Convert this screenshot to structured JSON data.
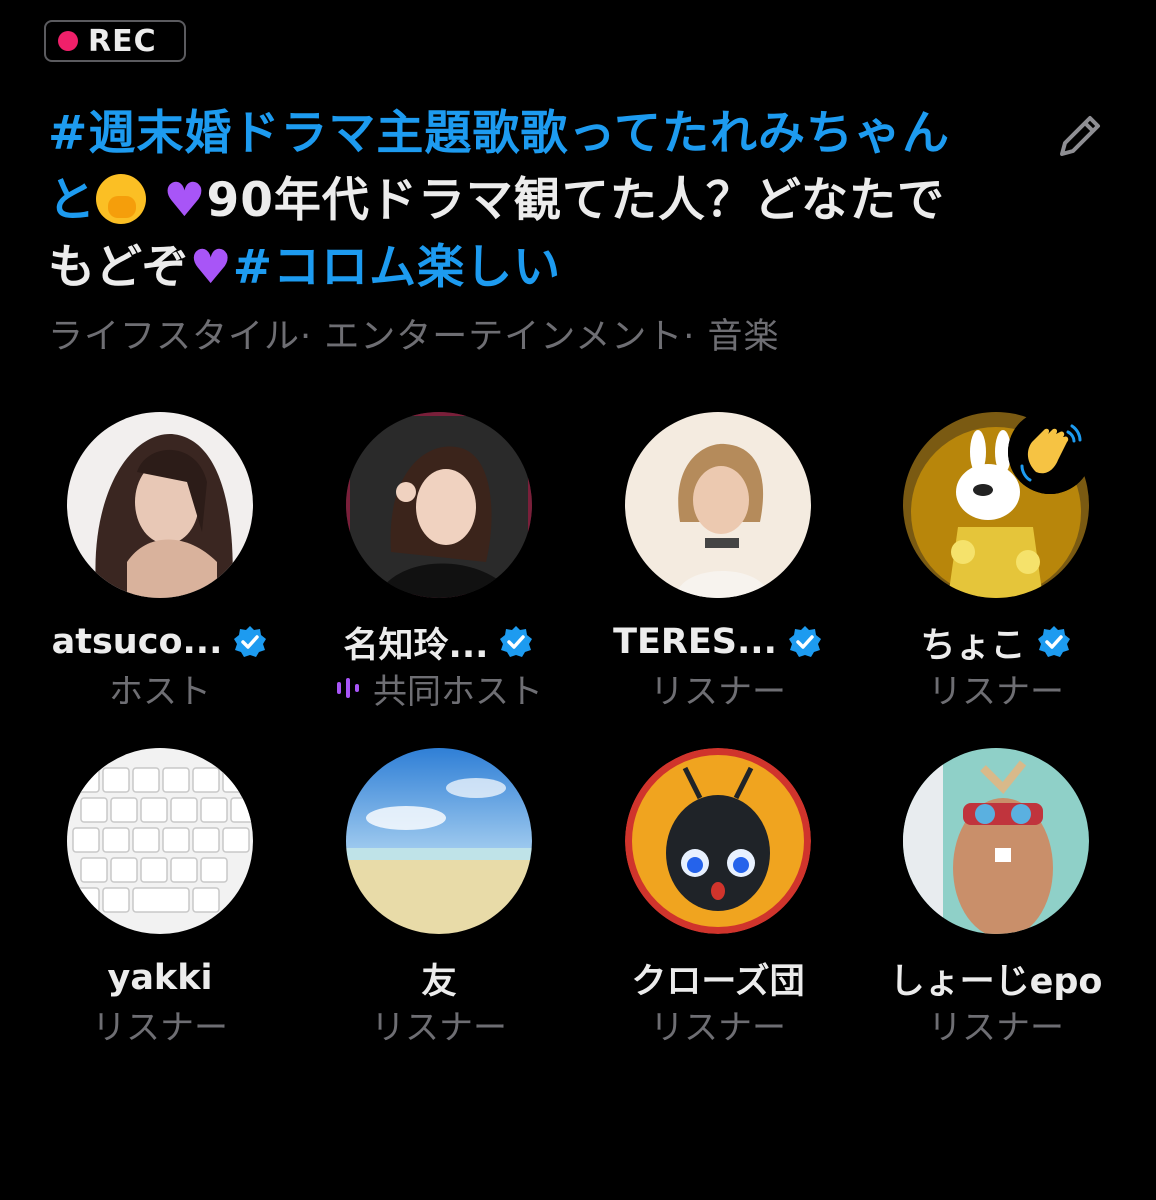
{
  "rec_badge": {
    "label": "REC"
  },
  "space": {
    "title_line1": "#週末婚ドラマ主題歌歌ってたれみちゃん",
    "title_line2_start": "と",
    "title_line2_after": "90年代ドラマ観てた人？どなたで",
    "title_line3_start": "もどぞ",
    "title_line3_tag": "#コロム楽しい",
    "categories": "ライフスタイル· エンターテインメント· 音楽"
  },
  "participants": [
    {
      "name": "atsuco...",
      "role": "ホスト",
      "verified": true,
      "speaking": false,
      "avatar": "woman-long-hair-photo"
    },
    {
      "name": "名知玲...",
      "role": "共同ホスト",
      "verified": true,
      "speaking": true,
      "avatar": "woman-black-top-photo"
    },
    {
      "name": "TERES...",
      "role": "リスナー",
      "verified": true,
      "speaking": false,
      "avatar": "woman-short-hair-photo"
    },
    {
      "name": "ちょこ",
      "role": "リスナー",
      "verified": true,
      "speaking": false,
      "avatar": "cartoon-rabbit-lemons",
      "reaction": "waving-hand"
    },
    {
      "name": "yakki",
      "role": "リスナー",
      "verified": false,
      "speaking": false,
      "avatar": "white-keyboard-photo"
    },
    {
      "name": "友",
      "role": "リスナー",
      "verified": false,
      "speaking": false,
      "avatar": "beach-sky-photo"
    },
    {
      "name": "クローズ団",
      "role": "リスナー",
      "verified": false,
      "speaking": false,
      "avatar": "cartoon-ant-robot"
    },
    {
      "name": "しょーじepo",
      "role": "リスナー",
      "verified": false,
      "speaking": false,
      "avatar": "plush-toy-photo"
    }
  ],
  "colors": {
    "background": "#000000",
    "hashtag": "#1d9bf0",
    "heart": "#a855f7",
    "rec_dot": "#f0206a",
    "verified": "#1d9bf0",
    "secondary_text": "#6e6e73"
  },
  "icons": {
    "edit": "pencil-icon",
    "verified": "verified-badge-icon",
    "speaking": "audio-wave-icon"
  }
}
